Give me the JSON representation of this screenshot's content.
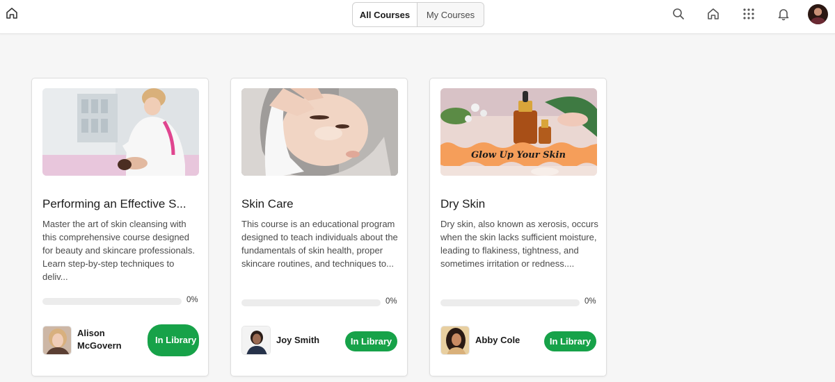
{
  "topbar": {
    "tabs": [
      {
        "label": "All Courses",
        "active": true
      },
      {
        "label": "My Courses",
        "active": false
      }
    ],
    "icons": [
      "home-icon",
      "search-icon",
      "home-icon",
      "apps-grid-icon",
      "bell-icon",
      "user-avatar"
    ]
  },
  "courses": [
    {
      "title": "Performing an Effective S...",
      "description": "Master the art of skin cleansing with this comprehensive course designed for beauty and skincare professionals. Learn step-by-step techniques to deliv...",
      "progress_label": "0%",
      "progress": 0,
      "author": "Alison McGovern",
      "status_label": "In Library"
    },
    {
      "title": "Skin Care",
      "description": "This course is an educational program designed to teach individuals about the fundamentals of skin health, proper skincare routines, and techniques to...",
      "progress_label": "0%",
      "progress": 0,
      "author": "Joy Smith",
      "status_label": "In Library"
    },
    {
      "title": "Dry Skin",
      "description": "Dry skin, also known as xerosis, occurs when the skin lacks sufficient moisture, leading to flakiness, tightness, and sometimes irritation or redness....",
      "progress_label": "0%",
      "progress": 0,
      "author": "Abby Cole",
      "status_label": "In Library",
      "thumbnail_text": "Glow Up Your Skin"
    }
  ],
  "colors": {
    "accent_green": "#17a249",
    "page_bg": "#f6f6f6",
    "progress_track": "#ececec"
  }
}
